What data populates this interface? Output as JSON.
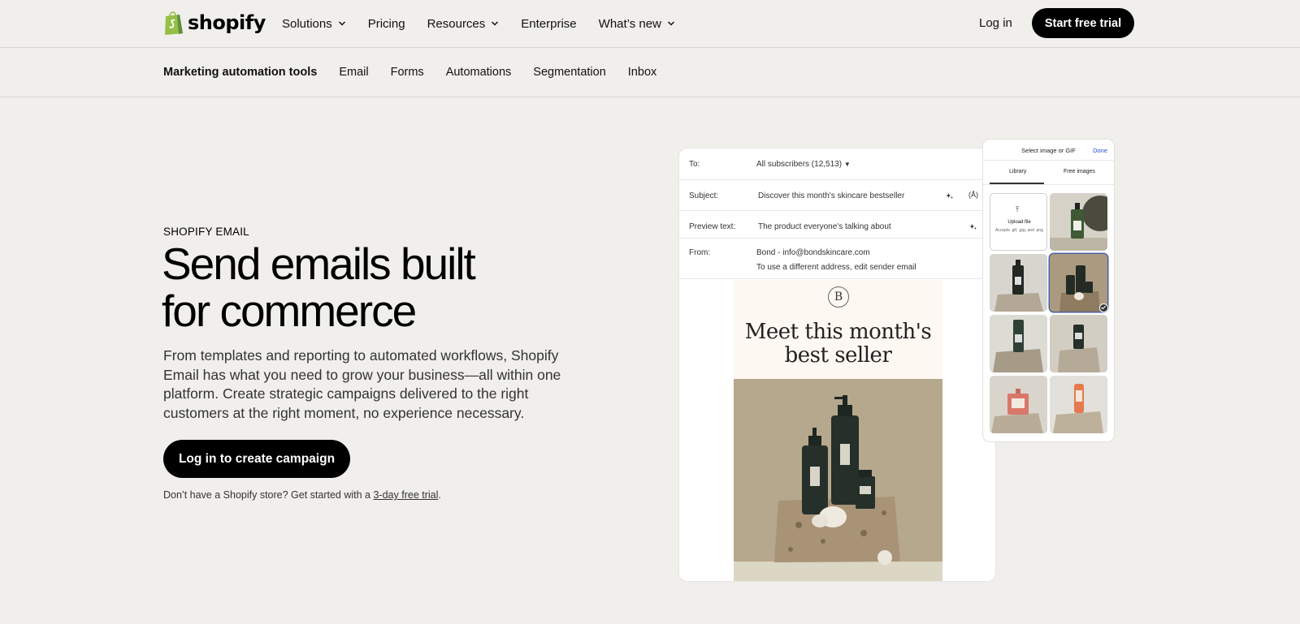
{
  "topnav": {
    "logo_text": "shopify",
    "items": [
      {
        "label": "Solutions",
        "dropdown": true
      },
      {
        "label": "Pricing",
        "dropdown": false
      },
      {
        "label": "Resources",
        "dropdown": true
      },
      {
        "label": "Enterprise",
        "dropdown": false
      },
      {
        "label": "What’s new",
        "dropdown": true
      }
    ],
    "login": "Log in",
    "cta": "Start free trial"
  },
  "subnav": {
    "items": [
      "Marketing automation tools",
      "Email",
      "Forms",
      "Automations",
      "Segmentation",
      "Inbox"
    ]
  },
  "hero": {
    "eyebrow": "SHOPIFY EMAIL",
    "headline_line1": "Send emails built",
    "headline_line2": "for commerce",
    "description": "From templates and reporting to automated workflows, Shopify Email has what you need to grow your business—all within one platform. Create strategic campaigns delivered to the right customers at the right moment, no experience necessary.",
    "cta": "Log in to create campaign",
    "footnote_prefix": "Don’t have a Shopify store? Get started with a ",
    "footnote_link": "3-day free trial",
    "footnote_suffix": "."
  },
  "email_editor": {
    "to_label": "To:",
    "to_value": "All subscribers (12,513)",
    "subject_label": "Subject:",
    "subject_value": "Discover this month's skincare bestseller",
    "preview_label": "Preview text:",
    "preview_value": "The product everyone's talking about",
    "from_label": "From:",
    "from_value": "Bond - info@bondskincare.com",
    "from_hint": "To use a different address, edit sender email",
    "brand_initial": "B",
    "heading_line1": "Meet this month's",
    "heading_line2": "best seller"
  },
  "image_picker": {
    "title": "Select image or GIF",
    "done": "Done",
    "tabs": [
      "Library",
      "Free images"
    ],
    "upload_label": "Upload file",
    "upload_hint": "Accepts .gif, .jpg, and .png"
  },
  "colors": {
    "background": "#f0efec",
    "primary_button": "#000000",
    "link_blue": "#1d4ed8",
    "logo_green": "#95bf47"
  }
}
